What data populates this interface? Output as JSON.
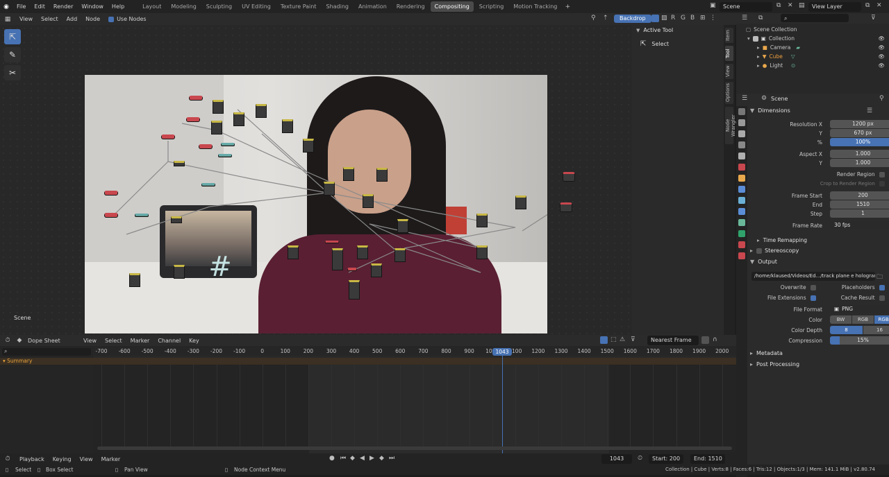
{
  "topbar": {
    "menus": [
      "File",
      "Edit",
      "Render",
      "Window",
      "Help"
    ],
    "workspaces": [
      "Layout",
      "Modeling",
      "Sculpting",
      "UV Editing",
      "Texture Paint",
      "Shading",
      "Animation",
      "Rendering",
      "Compositing",
      "Scripting",
      "Motion Tracking"
    ],
    "active_workspace": "Compositing",
    "scene": "Scene",
    "view_layer": "View Layer"
  },
  "node_editor": {
    "menus": [
      "View",
      "Select",
      "Add",
      "Node"
    ],
    "use_nodes_label": "Use Nodes",
    "backdrop_label": "Backdrop",
    "scene_label": "Scene",
    "sidebar_panel_title": "Active Tool",
    "sidebar_tool": "Select",
    "side_tabs": [
      "Item",
      "Tool",
      "View",
      "Options",
      "Node Wrangler"
    ]
  },
  "outliner": {
    "root": "Scene Collection",
    "items": [
      {
        "label": "Collection",
        "color": "#c8c8c8"
      },
      {
        "label": "Camera",
        "color": "#c8c8c8"
      },
      {
        "label": "Cube",
        "color": "#f0a040"
      },
      {
        "label": "Light",
        "color": "#c8c8c8"
      }
    ]
  },
  "properties": {
    "context": "Scene",
    "dimensions_title": "Dimensions",
    "resolution_x_label": "Resolution X",
    "resolution_x": "1200 px",
    "y_label": "Y",
    "resolution_y": "670 px",
    "percent_label": "%",
    "percent": "100%",
    "aspect_x_label": "Aspect X",
    "aspect_x": "1.000",
    "aspect_y": "1.000",
    "render_region": "Render Region",
    "crop_region": "Crop to Render Region",
    "frame_start_label": "Frame Start",
    "frame_start": "200",
    "end_label": "End",
    "frame_end": "1510",
    "step_label": "Step",
    "step": "1",
    "frame_rate_label": "Frame Rate",
    "frame_rate": "30 fps",
    "time_remapping": "Time Remapping",
    "stereoscopy": "Stereoscopy",
    "output_title": "Output",
    "output_path": "/home/klaused/Videos/Ed.../track plane e holograma",
    "overwrite": "Overwrite",
    "placeholders": "Placeholders",
    "file_extensions": "File Extensions",
    "cache_result": "Cache Result",
    "file_format_label": "File Format",
    "file_format": "PNG",
    "color_label": "Color",
    "color_modes": [
      "BW",
      "RGB",
      "RGBA"
    ],
    "color_depth_label": "Color Depth",
    "color_depths": [
      "8",
      "16"
    ],
    "compression_label": "Compression",
    "compression": "15%",
    "compression_fraction": 0.15,
    "metadata": "Metadata",
    "post_processing": "Post Processing"
  },
  "dopesheet": {
    "mode": "Dope Sheet",
    "menus": [
      "View",
      "Select",
      "Marker",
      "Channel",
      "Key"
    ],
    "snapping": "Nearest Frame",
    "summary": "Summary",
    "ticks": [
      "-700",
      "-600",
      "-500",
      "-400",
      "-300",
      "-200",
      "-100",
      "0",
      "100",
      "200",
      "300",
      "400",
      "500",
      "600",
      "700",
      "800",
      "900",
      "1000",
      "1100",
      "1200",
      "1300",
      "1400",
      "1500",
      "1600",
      "1700",
      "1800",
      "1900",
      "2000"
    ],
    "current_frame": "1043"
  },
  "timeline_footer": {
    "menus": [
      "Playback",
      "Keying",
      "View",
      "Marker"
    ],
    "current_frame": "1043",
    "start_label": "Start:",
    "start": "200",
    "end_label": "End:",
    "end": "1510"
  },
  "statusbar": {
    "select": "Select",
    "box_select": "Box Select",
    "pan_view": "Pan View",
    "context_menu": "Node Context Menu",
    "stats": "Collection | Cube | Verts:8 | Faces:6 | Tris:12 | Objects:1/3 | Mem: 141.1 MiB | v2.80.74"
  }
}
